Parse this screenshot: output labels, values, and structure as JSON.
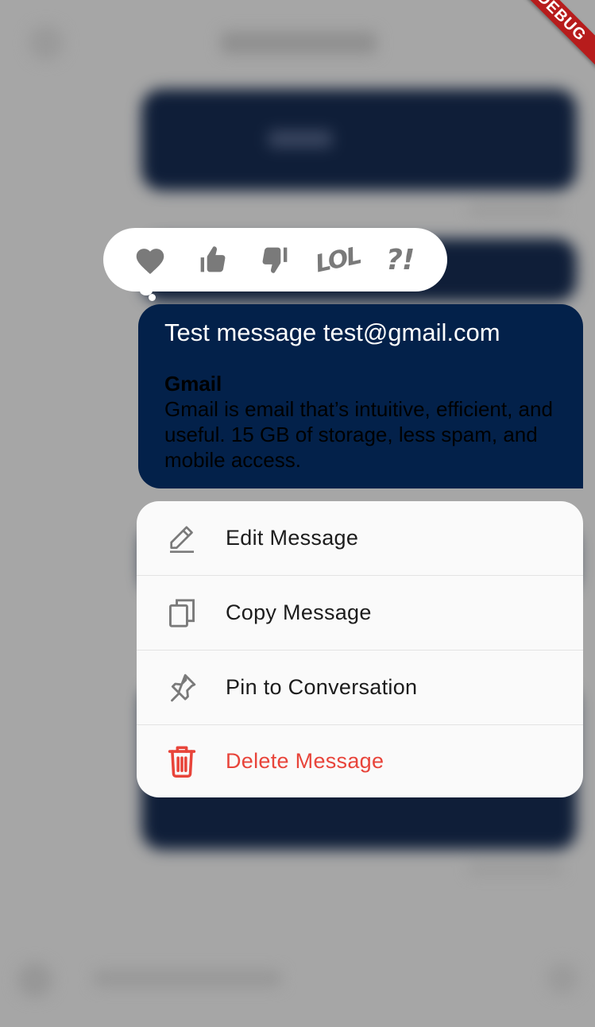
{
  "debug_banner": {
    "label": "DEBUG"
  },
  "reactions": [
    {
      "id": "love",
      "icon": "heart-icon"
    },
    {
      "id": "like",
      "icon": "thumbs-up-icon"
    },
    {
      "id": "dislike",
      "icon": "thumbs-down-icon"
    },
    {
      "id": "lol",
      "icon": "lol-text-icon",
      "text": "LOL"
    },
    {
      "id": "question",
      "icon": "question-exclaim-icon",
      "text": "?!"
    }
  ],
  "message": {
    "text": "Test message test@gmail.com",
    "link_preview": {
      "title": "Gmail",
      "description": "Gmail is email that’s intuitive, efficient, and useful. 15 GB of storage, less spam, and mobile access."
    }
  },
  "context_menu": {
    "items": [
      {
        "id": "edit",
        "label": "Edit Message",
        "icon": "pencil-icon"
      },
      {
        "id": "copy",
        "label": "Copy Message",
        "icon": "copy-icon"
      },
      {
        "id": "pin",
        "label": "Pin to Conversation",
        "icon": "pin-icon"
      },
      {
        "id": "delete",
        "label": "Delete Message",
        "icon": "trash-icon",
        "danger": true
      }
    ]
  },
  "colors": {
    "bubble": "#03214a",
    "danger": "#e8443a",
    "icon_gray": "#7a7a7a",
    "menu_bg": "#fafafa"
  }
}
